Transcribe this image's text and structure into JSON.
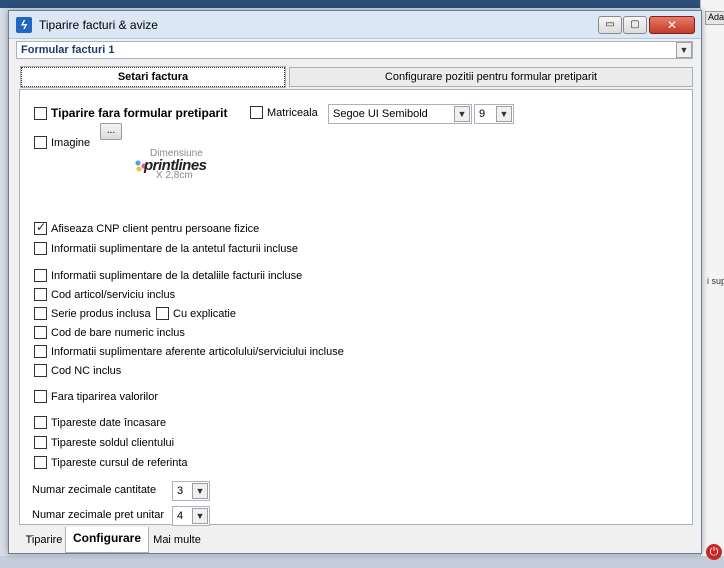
{
  "background": {
    "right_cells": [
      "Ada",
      "i sup"
    ],
    "stop_icon": "power-icon"
  },
  "window": {
    "title": "Tiparire facturi & avize",
    "icon": "lightning-icon",
    "controls": {
      "minimize": "▭",
      "maximize": "▢",
      "close": "✕"
    }
  },
  "formular_select": {
    "value": "Formular facturi 1"
  },
  "tabs": [
    {
      "label": "Setari factura",
      "active": true
    },
    {
      "label": "Configurare pozitii pentru formular pretiparit",
      "active": false
    }
  ],
  "settings": {
    "tiparire_fara_formular": {
      "label": "Tiparire fara formular pretiparit",
      "checked": false
    },
    "matriceala": {
      "label": "Matriceala",
      "checked": false
    },
    "font_name": "Segoe UI Semibold",
    "font_size": "9",
    "imagine": {
      "label": "Imagine",
      "checked": false,
      "browse_label": "..."
    },
    "logo": {
      "dim_label": "Dimensiune",
      "brand": "printlines",
      "size_label": "X 2,8cm"
    },
    "options": [
      {
        "label": "Afiseaza CNP client pentru persoane fizice",
        "checked": true
      },
      {
        "label": "Informatii suplimentare de la antetul facturii incluse",
        "checked": false
      },
      {
        "label": "Informatii suplimentare de la detaliile facturii incluse",
        "checked": false
      },
      {
        "label": "Cod articol/serviciu inclus",
        "checked": false
      },
      {
        "label": "Serie produs inclusa",
        "checked": false
      },
      {
        "label": "Cod de bare numeric inclus",
        "checked": false
      },
      {
        "label": "Informatii suplimentare aferente articolului/serviciului incluse",
        "checked": false
      },
      {
        "label": "Cod NC inclus",
        "checked": false
      },
      {
        "label": "Fara tiparirea valorilor",
        "checked": false
      },
      {
        "label": "Tipareste date încasare",
        "checked": false
      },
      {
        "label": "Tipareste soldul clientului",
        "checked": false
      },
      {
        "label": "Tipareste cursul de referinta",
        "checked": false
      }
    ],
    "cu_explicatie": {
      "label": "Cu explicatie",
      "checked": false
    },
    "zecimale_cantitate": {
      "label": "Numar zecimale cantitate",
      "value": "3"
    },
    "zecimale_pret": {
      "label": "Numar zecimale pret unitar",
      "value": "4"
    }
  },
  "bottom_tabs": [
    {
      "label": "Tiparire",
      "active": false
    },
    {
      "label": "Configurare",
      "active": true
    },
    {
      "label": "Mai multe",
      "active": false
    }
  ],
  "colors": {
    "title_bar": "#dbe7f5",
    "close_button": "#c43b28",
    "formular_text": "#1a3d6d"
  }
}
